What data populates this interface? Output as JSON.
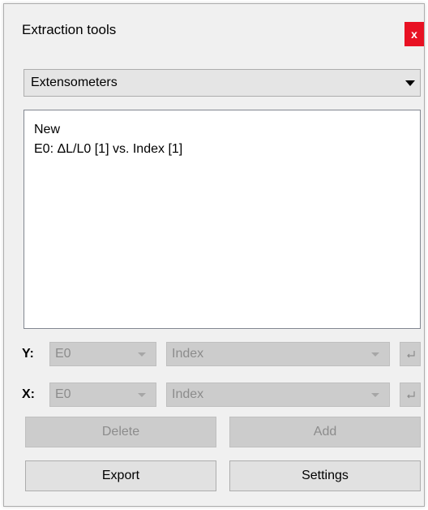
{
  "window": {
    "title": "Extraction tools",
    "close_label": "x"
  },
  "category_select": {
    "value": "Extensometers"
  },
  "list": {
    "items": [
      {
        "label": "New"
      },
      {
        "label": "E0: ΔL/L0 [1] vs. Index [1]"
      }
    ]
  },
  "y_axis": {
    "label": "Y:",
    "source_value": "E0",
    "column_value": "Index"
  },
  "x_axis": {
    "label": "X:",
    "source_value": "E0",
    "column_value": "Index"
  },
  "buttons": {
    "delete": "Delete",
    "add": "Add",
    "export": "Export",
    "settings": "Settings"
  },
  "colors": {
    "close_button": "#e81123",
    "disabled_fill": "#cccccc",
    "disabled_text": "#8c8c8c",
    "button_fill": "#e1e1e1",
    "window_bg": "#f0f0f0"
  },
  "icons": {
    "close": "close-icon",
    "dropdown": "chevron-down-icon",
    "enter": "enter-icon"
  }
}
